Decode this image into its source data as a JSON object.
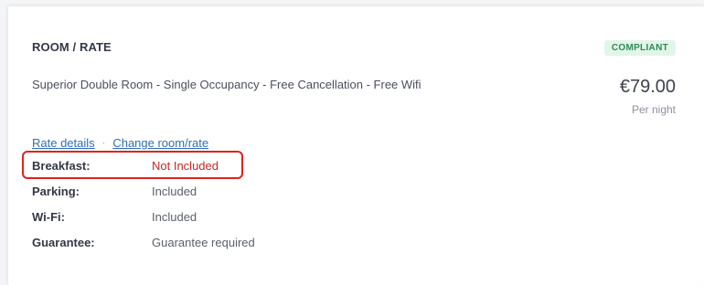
{
  "section": {
    "title": "ROOM / RATE",
    "status_badge": "COMPLIANT"
  },
  "room": {
    "description": "Superior Double Room - Single Occupancy - Free Cancellation - Free Wifi",
    "price": "€79.00",
    "price_unit": "Per night"
  },
  "links": {
    "rate_details": "Rate details",
    "separator": "·",
    "change_room_rate": "Change room/rate"
  },
  "amenities": [
    {
      "label": "Breakfast:",
      "value": "Not Included"
    },
    {
      "label": "Parking:",
      "value": "Included"
    },
    {
      "label": "Wi-Fi:",
      "value": "Included"
    },
    {
      "label": "Guarantee:",
      "value": "Guarantee required"
    }
  ],
  "colors": {
    "badge_text": "#2e8b57",
    "badge_bg": "#e2f5e9",
    "link": "#2c6fb7",
    "highlight_border": "#e2231a",
    "not_included_text": "#c62828"
  }
}
